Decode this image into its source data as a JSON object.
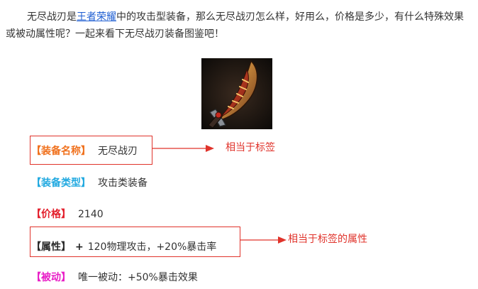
{
  "intro": {
    "before_link": "无尽战刃是",
    "link_text": "王者荣耀",
    "after_link": "中的攻击型装备，那么无尽战刃怎么样，好用么，价格是多少，有什么特殊效果或被动属性呢？一起来看下无尽战刃装备图鉴吧！"
  },
  "item_image": {
    "icon": "infinity-blade-sword-icon"
  },
  "rows": {
    "name": {
      "label": "【装备名称】",
      "value": "无尽战刃"
    },
    "type": {
      "label": "【装备类型】",
      "value": "攻击类装备"
    },
    "price": {
      "label": "【价格】",
      "value": "2140"
    },
    "attr": {
      "label": "【属性】",
      "plus": "+",
      "value": "120物理攻击，+20%暴击率"
    },
    "passive": {
      "label": "【被动】",
      "value": "唯一被动：+50%暴击效果"
    }
  },
  "annotations": {
    "label_note": "相当于标签",
    "attr_note": "相当于标签的属性"
  },
  "colors": {
    "name_label": "#f0711d",
    "type_label": "#21a9e0",
    "price_label": "#e3202d",
    "attr_label": "#2a2a2a",
    "passive_label": "#e81ec6",
    "annotation": "#e0332b",
    "link": "#1e5ed2"
  }
}
